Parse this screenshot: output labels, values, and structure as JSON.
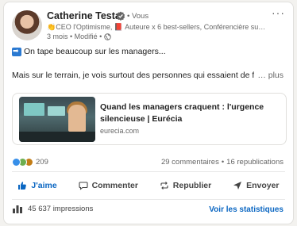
{
  "post": {
    "author": {
      "name": "Catherine Testa",
      "degree": "• Vous",
      "headline": "👏CEO l'Optimisme, 📕 Auteure x 6 best-sellers, Conférencière sur l'...",
      "meta": "3 mois • Modifié •"
    },
    "body": {
      "line1": "On tape beaucoup sur les managers...",
      "line2": "Mais sur le terrain, je vois surtout des personnes qui essaient de faire",
      "see_more": "… plus"
    },
    "link_preview": {
      "title": "Quand les managers craquent : l'urgence silencieuse | Eurécia",
      "domain": "eurecia.com"
    },
    "social": {
      "reaction_count": "209",
      "comments": "29 commentaires",
      "separator": "•",
      "reposts": "16 republications"
    },
    "actions": {
      "like": "J'aime",
      "comment": "Commenter",
      "repost": "Republier",
      "send": "Envoyer"
    },
    "footer": {
      "impressions": "45 637 impressions",
      "view_stats": "Voir les statistiques"
    }
  },
  "colors": {
    "accent": "#0a66c2",
    "text": "#1f1f1f",
    "muted": "#666666"
  }
}
